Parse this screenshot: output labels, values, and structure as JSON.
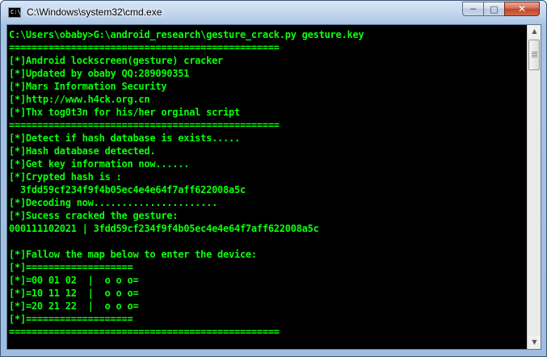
{
  "window": {
    "title": "C:\\Windows\\system32\\cmd.exe",
    "icon_text": "C:\\",
    "controls": {
      "minimize": "─",
      "maximize": "□",
      "close": "✕"
    }
  },
  "colors": {
    "console_text": "#0bff0b",
    "console_bg": "#000000"
  },
  "console": {
    "lines": [
      "C:\\Users\\obaby>G:\\android_research\\gesture_crack.py gesture.key",
      "================================================",
      "[*]Android lockscreen(gesture) cracker",
      "[*]Updated by obaby QQ:289090351",
      "[*]Mars Information Security",
      "[*]http://www.h4ck.org.cn",
      "[*]Thx tog0t3n for his/her orginal script",
      "================================================",
      "[*]Detect if hash database is exists.....",
      "[*]Hash database detected.",
      "[*]Get key information now......",
      "[*]Crypted hash is :",
      "  3fdd59cf234f9f4b05ec4e4e64f7aff622008a5c",
      "[*]Decoding now......................",
      "[*]Sucess cracked the gesture:",
      "000111102021 | 3fdd59cf234f9f4b05ec4e4e64f7aff622008a5c",
      "",
      "[*]Fallow the map below to enter the device:",
      "[*]===================",
      "[*]=00 01 02  |  o o o=",
      "[*]=10 11 12  |  o o o=",
      "[*]=20 21 22  |  o o o=",
      "[*]===================",
      "================================================"
    ]
  }
}
